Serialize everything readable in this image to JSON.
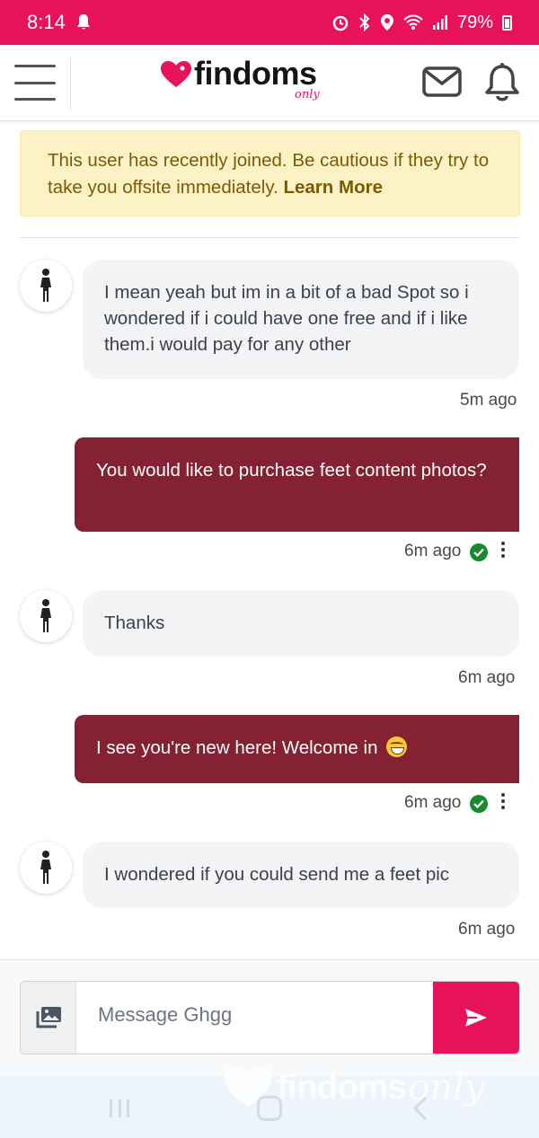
{
  "status_bar": {
    "time": "8:14",
    "battery": "79%",
    "icons": [
      "notification-bell-icon",
      "alarm-icon",
      "bluetooth-icon",
      "location-icon",
      "wifi-icon",
      "signal-icon",
      "battery-icon"
    ]
  },
  "header": {
    "brand": "findoms",
    "brand_suffix": "only",
    "icons": [
      "hamburger-menu-icon",
      "mail-icon",
      "bell-icon"
    ]
  },
  "warning": {
    "text": "This user has recently joined. Be cautious if they try to take you offsite immediately.",
    "link": "Learn More"
  },
  "messages": [
    {
      "direction": "in",
      "text": "I mean yeah but im in a bit of a bad Spot so i wondered if i could have one free and if i like them.i would pay for any other",
      "time": "5m ago"
    },
    {
      "direction": "out",
      "text": "You would like to purchase feet content photos?",
      "time": "6m ago",
      "status": "delivered"
    },
    {
      "direction": "in",
      "text": "Thanks",
      "time": "6m ago"
    },
    {
      "direction": "out",
      "text": "I see you're new here! Welcome in",
      "emoji": "grinning-face",
      "time": "6m ago",
      "status": "delivered"
    },
    {
      "direction": "in",
      "text": "I wondered if you could send me a feet pic",
      "time": "6m ago"
    }
  ],
  "composer": {
    "placeholder": "Message Ghgg"
  },
  "watermark": {
    "brand": "findoms",
    "suffix": "only"
  },
  "colors": {
    "accent": "#e8125b",
    "outgoing_bubble": "#842133",
    "incoming_bubble": "#f3f4f6",
    "warning_bg": "#fdf2c6",
    "delivered_check": "#178a2d"
  }
}
